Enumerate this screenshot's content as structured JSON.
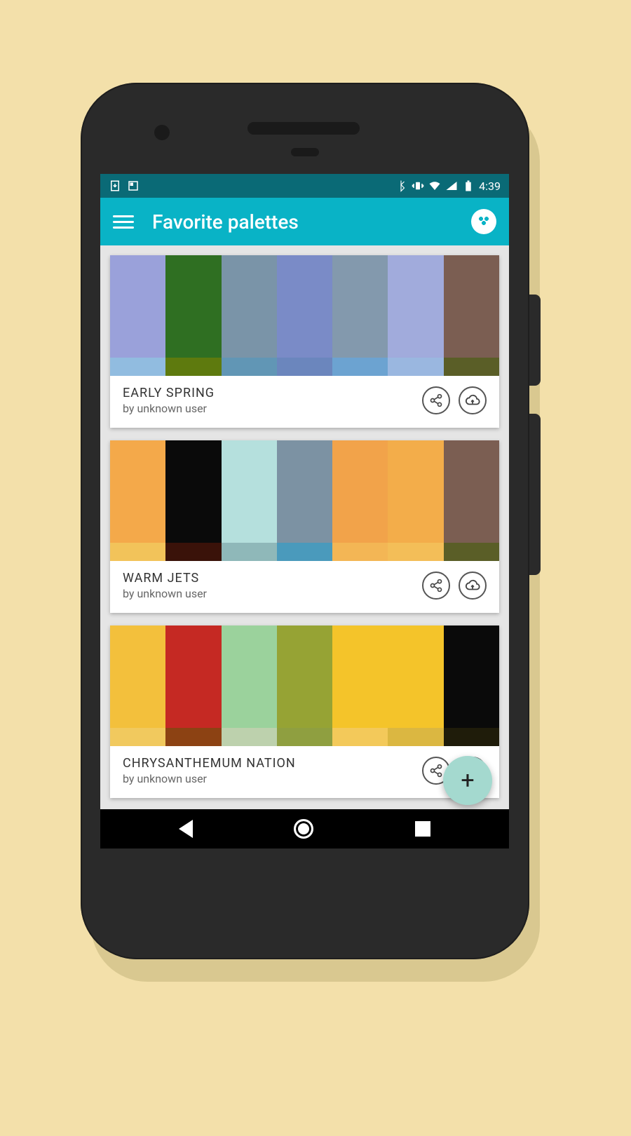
{
  "status": {
    "time": "4:39"
  },
  "appbar": {
    "title": "Favorite palettes"
  },
  "palettes": [
    {
      "name": "EARLY SPRING",
      "author": "by unknown user",
      "colors": [
        {
          "main": "#9aa1da",
          "foot": "#91bce0"
        },
        {
          "main": "#2f6f22",
          "foot": "#5e7a0e"
        },
        {
          "main": "#7a94a8",
          "foot": "#6196b5"
        },
        {
          "main": "#7a8bc7",
          "foot": "#6b86bd"
        },
        {
          "main": "#8399ad",
          "foot": "#6ca3d1"
        },
        {
          "main": "#a1abdc",
          "foot": "#9ab7e0"
        },
        {
          "main": "#7b5e52",
          "foot": "#5a5e27"
        }
      ]
    },
    {
      "name": "WARM JETS",
      "author": "by unknown user",
      "colors": [
        {
          "main": "#f4a94a",
          "foot": "#f2c35a"
        },
        {
          "main": "#0a0a0a",
          "foot": "#3a1209"
        },
        {
          "main": "#b5e0dd",
          "foot": "#8fb8b9"
        },
        {
          "main": "#7c92a3",
          "foot": "#4a9abc"
        },
        {
          "main": "#f2a34a",
          "foot": "#f3b655"
        },
        {
          "main": "#f3ad4a",
          "foot": "#f3be58"
        },
        {
          "main": "#7b5e52",
          "foot": "#5a5e27"
        }
      ]
    },
    {
      "name": "CHRYSANTHEMUM NATION",
      "author": "by unknown user",
      "colors": [
        {
          "main": "#f3c03c",
          "foot": "#f1c95e"
        },
        {
          "main": "#c52923",
          "foot": "#8c4213"
        },
        {
          "main": "#9bd29c",
          "foot": "#bdd1ad"
        },
        {
          "main": "#96a334",
          "foot": "#8f9f40"
        },
        {
          "main": "#f4c42a",
          "foot": "#f3c95a"
        },
        {
          "main": "#f4c42a",
          "foot": "#dbb741"
        },
        {
          "main": "#0a0a0a",
          "foot": "#1f1c0a"
        }
      ]
    }
  ],
  "fab": {
    "label": "+"
  }
}
